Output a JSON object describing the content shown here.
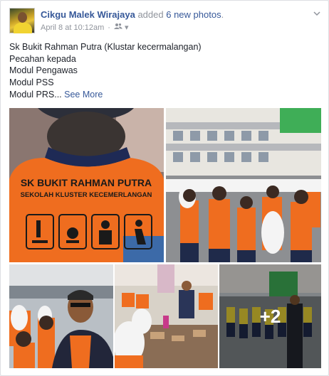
{
  "post": {
    "author": "Cikgu Malek Wirajaya",
    "action": "added",
    "count_text": "6 new photos",
    "period": ".",
    "timestamp": "April 8 at 10:12am",
    "separator": "·",
    "audience_icon": "friends-icon",
    "audience_chevron": "▾",
    "menu_chevron": "⌄"
  },
  "body": {
    "lines": [
      "Sk Bukit Rahman Putra (Klustar kecermalangan)",
      "Pecahan kepada",
      "Modul Pengawas",
      "Modul PSS"
    ],
    "last_line": "Modul PRS...",
    "see_more": "See More"
  },
  "photo_1": {
    "shirt_line_1": "SK BUKIT RAHMAN PUTRA",
    "shirt_line_2": "SEKOLAH KLUSTER KECEMERLANGAN"
  },
  "more_photos": "+2",
  "colors": {
    "link": "#365899",
    "meta": "#90949c",
    "uniform_orange": "#ef6d1f"
  }
}
